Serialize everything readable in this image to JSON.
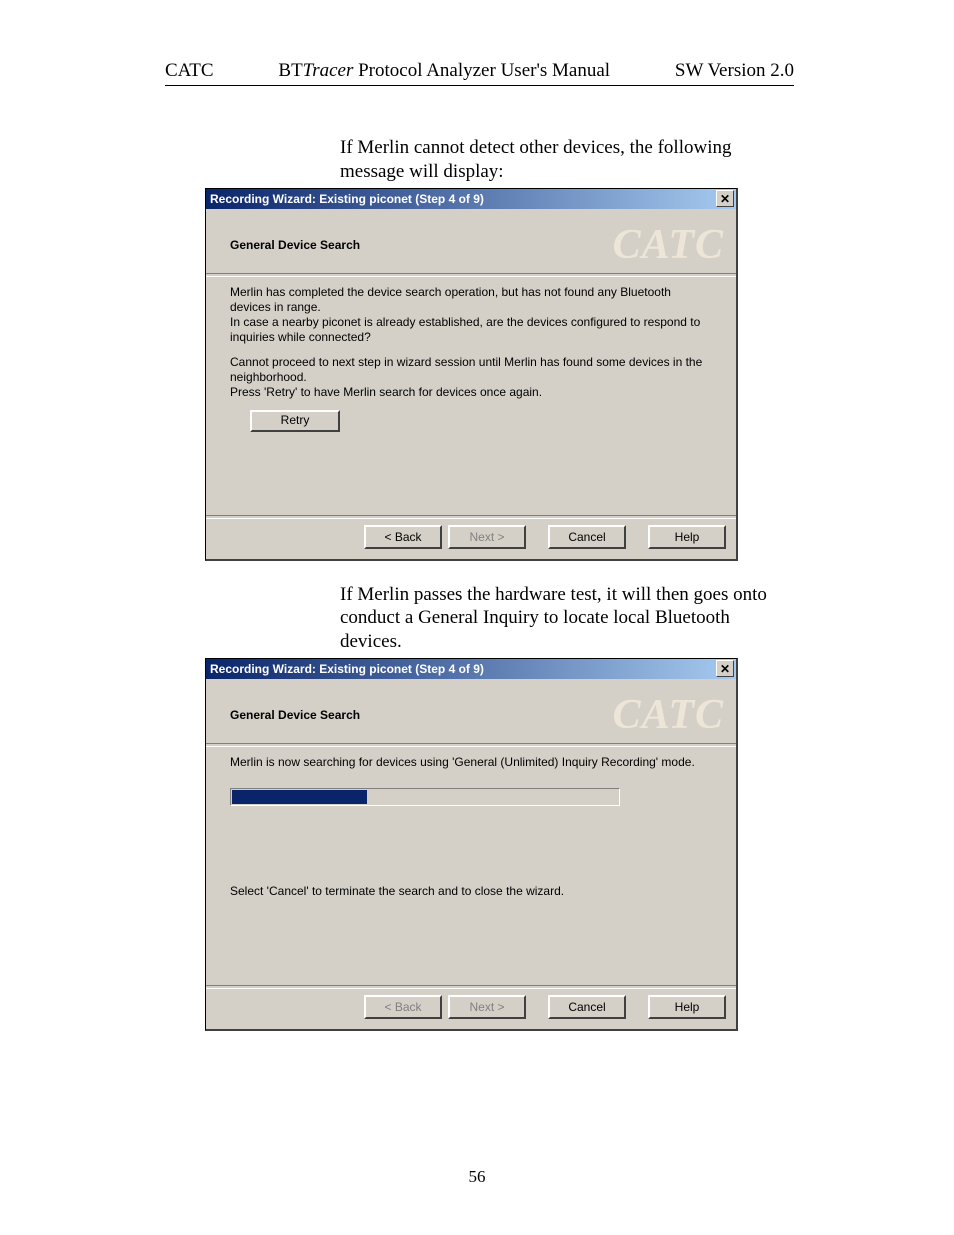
{
  "header": {
    "left": "CATC",
    "mid_prefix": "BT",
    "mid_italic": "Tracer",
    "mid_suffix": " Protocol Analyzer User's Manual",
    "right": "SW Version 2.0"
  },
  "intro1": "If Merlin cannot detect other devices, the following message will display:",
  "dialog1": {
    "title": "Recording Wizard: Existing piconet (Step 4 of 9)",
    "subhead": "General Device Search",
    "watermark": "CATC",
    "para1": "Merlin has completed the device search operation, but has not found any Bluetooth devices in range.\nIn case a nearby piconet is already established, are the devices configured to respond to inquiries while connected?",
    "para2": "Cannot proceed to next step in wizard session until Merlin has found some devices in the neighborhood.\nPress 'Retry' to have Merlin    search for devices once again.",
    "retry": "Retry",
    "buttons": {
      "back": "< Back",
      "next": "Next >",
      "cancel": "Cancel",
      "help": "Help"
    }
  },
  "intro2": "If  Merlin passes the hardware test, it will then goes onto conduct a General Inquiry to locate local Bluetooth devices.",
  "dialog2": {
    "title": "Recording Wizard: Existing piconet (Step 4 of 9)",
    "subhead": "General Device Search",
    "watermark": "CATC",
    "para1": "Merlin is now searching for devices using 'General (Unlimited) Inquiry Recording' mode.",
    "progress_percent": 35,
    "para2": "Select 'Cancel' to terminate the search and to close the wizard.",
    "buttons": {
      "back": "< Back",
      "next": "Next >",
      "cancel": "Cancel",
      "help": "Help"
    }
  },
  "page_number": "56"
}
